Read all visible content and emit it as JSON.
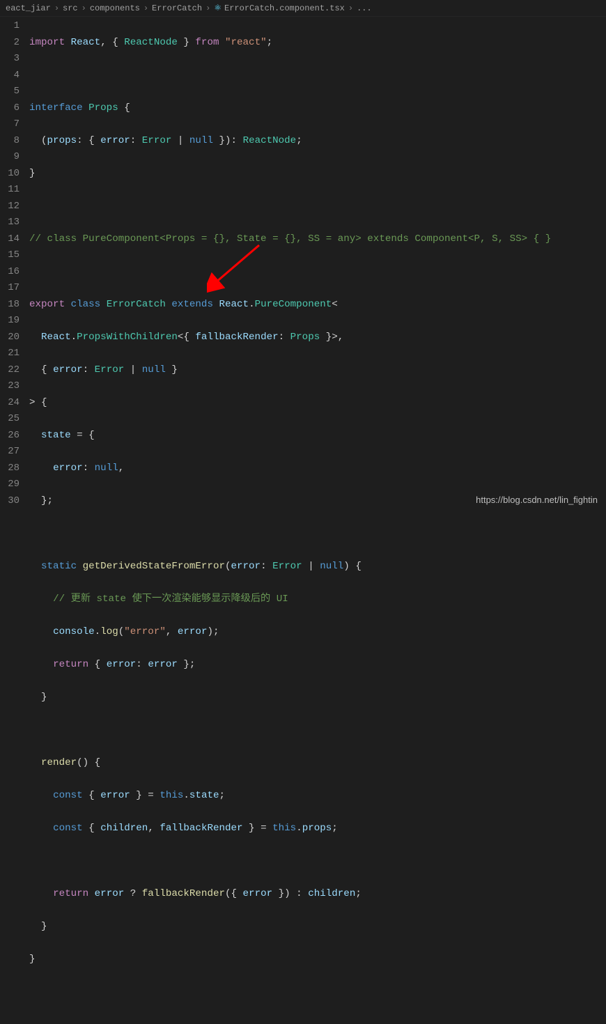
{
  "breadcrumb": {
    "items": [
      "eact_jiar",
      "src",
      "components",
      "ErrorCatch",
      "ErrorCatch.component.tsx",
      "..."
    ],
    "fileIcon": "react-icon"
  },
  "lines": {
    "count": 30,
    "l1_import": "import",
    "l1_react": " React",
    "l1_p1": ", { ",
    "l1_reactnode": "ReactNode",
    "l1_p2": " } ",
    "l1_from": "from",
    "l1_str": " \"react\"",
    "l1_semi": ";",
    "l3_interface": "interface",
    "l3_props": " Props",
    "l3_brace": " {",
    "l4_p1": "  (",
    "l4_props": "props",
    "l4_p2": ": { ",
    "l4_error": "error",
    "l4_p3": ": ",
    "l4_Error": "Error",
    "l4_p4": " | ",
    "l4_null": "null",
    "l4_p5": " }): ",
    "l4_ReactNode": "ReactNode",
    "l4_semi": ";",
    "l5_brace": "}",
    "l7_comment": "// class PureComponent<Props = {}, State = {}, SS = any> extends Component<P, S, SS> { }",
    "l9_export": "export",
    "l9_class": " class",
    "l9_ErrorCatch": " ErrorCatch",
    "l9_extends": " extends",
    "l9_React": " React",
    "l9_dot": ".",
    "l9_PureComponent": "PureComponent",
    "l9_lt": "<",
    "l10_React": "React",
    "l10_dot": ".",
    "l10_PWC": "PropsWithChildren",
    "l10_p1": "<{ ",
    "l10_fb": "fallbackRender",
    "l10_p2": ": ",
    "l10_Props": "Props",
    "l10_p3": " }>,",
    "l11_p1": "{ ",
    "l11_error": "error",
    "l11_p2": ": ",
    "l11_Error": "Error",
    "l11_p3": " | ",
    "l11_null": "null",
    "l11_p4": " }",
    "l12_gt": "> {",
    "l13_state": "state",
    "l13_eq": " = {",
    "l14_error": "error",
    "l14_p1": ": ",
    "l14_null": "null",
    "l14_comma": ",",
    "l15_brace": "};",
    "l17_static": "static",
    "l17_func": " getDerivedStateFromError",
    "l17_p1": "(",
    "l17_error": "error",
    "l17_p2": ": ",
    "l17_Error": "Error",
    "l17_p3": " | ",
    "l17_null": "null",
    "l17_p4": ") {",
    "l18_comment": "// 更新 state 使下一次渲染能够显示降级后的 UI",
    "l19_console": "console",
    "l19_dot": ".",
    "l19_log": "log",
    "l19_p1": "(",
    "l19_str": "\"error\"",
    "l19_p2": ", ",
    "l19_error": "error",
    "l19_p3": ");",
    "l20_return": "return",
    "l20_p1": " { ",
    "l20_error1": "error",
    "l20_p2": ": ",
    "l20_error2": "error",
    "l20_p3": " };",
    "l21_brace": "}",
    "l23_render": "render",
    "l23_p": "() {",
    "l24_const": "const",
    "l24_p1": " { ",
    "l24_error": "error",
    "l24_p2": " } = ",
    "l24_this": "this",
    "l24_dot": ".",
    "l24_state": "state",
    "l24_semi": ";",
    "l25_const": "const",
    "l25_p1": " { ",
    "l25_children": "children",
    "l25_p2": ", ",
    "l25_fb": "fallbackRender",
    "l25_p3": " } = ",
    "l25_this": "this",
    "l25_dot": ".",
    "l25_props": "props",
    "l25_semi": ";",
    "l27_return": "return",
    "l27_sp": " ",
    "l27_error": "error",
    "l27_q": " ? ",
    "l27_fb": "fallbackRender",
    "l27_p1": "({ ",
    "l27_error2": "error",
    "l27_p2": " }) : ",
    "l27_children": "children",
    "l27_semi": ";",
    "l28_brace": "}",
    "l29_brace": "}"
  },
  "watermark": "https://blog.csdn.net/lin_fightin",
  "colors": {
    "arrow": "#ff0000"
  }
}
